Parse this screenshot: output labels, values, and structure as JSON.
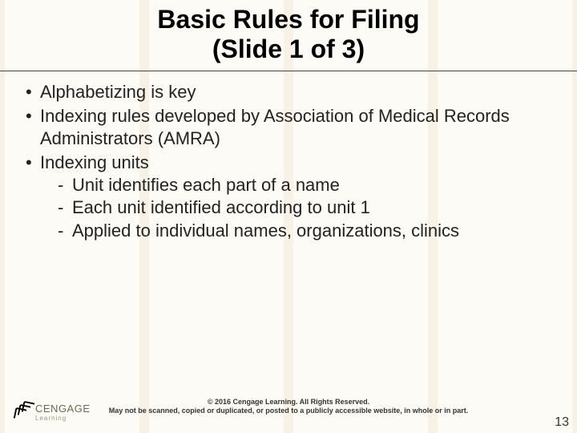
{
  "title": {
    "line1": "Basic Rules for Filing",
    "line2": "(Slide 1 of 3)"
  },
  "bullets": [
    {
      "text": "Alphabetizing is key"
    },
    {
      "text": "Indexing rules developed by Association of Medical Records Administrators (AMRA)"
    },
    {
      "text": "Indexing units",
      "sub": [
        "Unit identifies each part of a name",
        "Each unit identified according to unit 1",
        "Applied to individual names, organizations, clinics"
      ]
    }
  ],
  "footer": {
    "line1": "© 2016 Cengage Learning. All Rights Reserved.",
    "line2": "May not be scanned, copied or duplicated, or posted to a publicly accessible website, in whole or in part."
  },
  "page_number": "13",
  "logo": {
    "brand": "CENGAGE",
    "sub": "Learning"
  }
}
